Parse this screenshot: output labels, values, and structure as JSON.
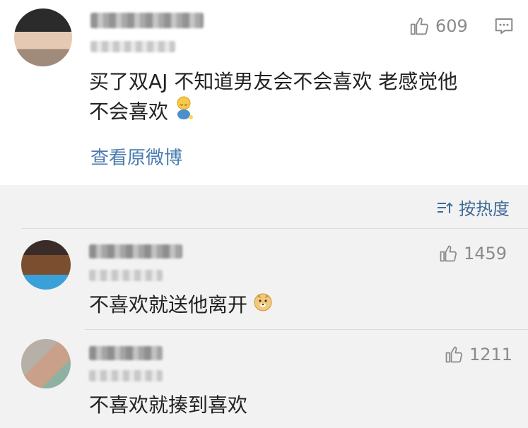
{
  "post": {
    "like_count": "609",
    "text_line1": "买了双AJ  不知道男友会不会喜欢  老感觉他",
    "text_line2": "不会喜欢",
    "view_original_label": "查看原微博"
  },
  "sort": {
    "label": "按热度"
  },
  "comments": [
    {
      "like_count": "1459",
      "text": "不喜欢就送他离开"
    },
    {
      "like_count": "1211",
      "text": "不喜欢就揍到喜欢"
    }
  ],
  "icons": {
    "like": "thumbs-up-icon",
    "comment": "comment-icon",
    "sort": "sort-icon"
  },
  "colors": {
    "link": "#4a7cb0",
    "sort": "#3f6b99",
    "meta": "#8a8a8a",
    "text": "#222222"
  }
}
